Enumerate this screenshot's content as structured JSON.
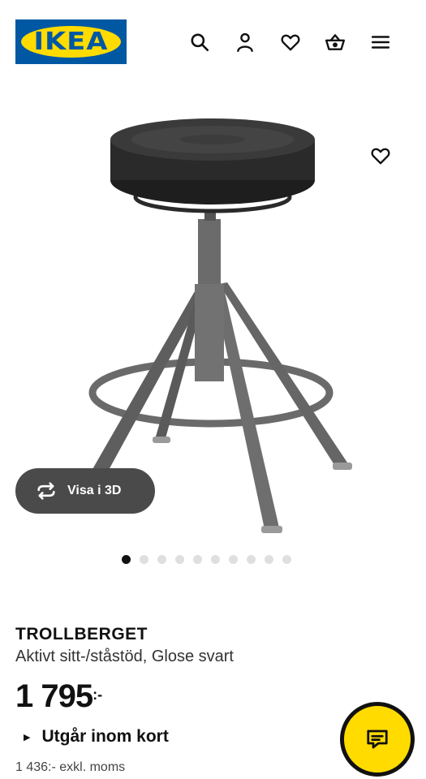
{
  "header": {
    "logo_text": "IKEA",
    "icons": [
      "search-icon",
      "user-icon",
      "heart-icon",
      "basket-icon",
      "menu-icon"
    ]
  },
  "gallery": {
    "view3d_label": "Visa i 3D",
    "dot_count": 10,
    "active_dot": 0
  },
  "product": {
    "name": "TROLLBERGET",
    "description": "Aktivt sitt-/ståstöd, Glose svart",
    "price": "1 795",
    "price_suffix": ":-",
    "status": "Utgår inom kort",
    "price_excl_vat": "1 436:- exkl. moms"
  },
  "colors": {
    "brand_blue": "#0058a3",
    "brand_yellow": "#ffdb00",
    "button_dark": "#4a4a4a"
  }
}
